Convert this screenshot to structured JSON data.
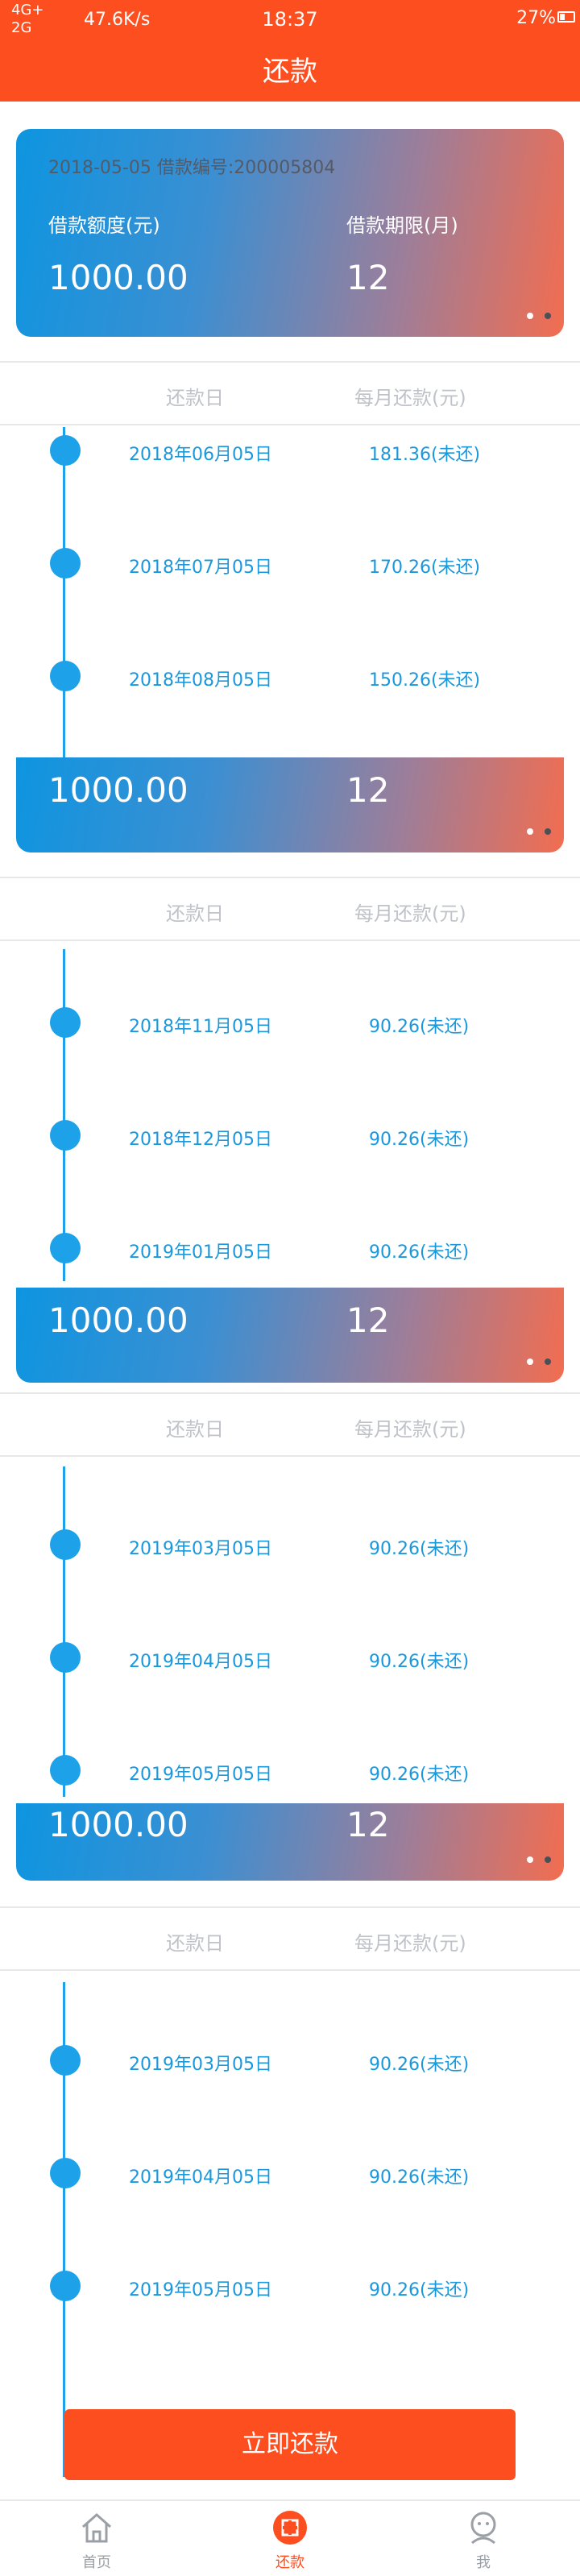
{
  "status_bar": {
    "network_top": "4G+",
    "network_bottom": "2G",
    "speed": "47.6K/s",
    "time": "18:37",
    "battery": "27%"
  },
  "title": "还款",
  "card": {
    "date": "2018-05-05",
    "loan_no_label": "借款编号:200005804",
    "amount_label": "借款额度(元)",
    "term_label": "借款期限(月)",
    "amount": "1000.00",
    "term": "12"
  },
  "table_header": {
    "date_col": "还款日",
    "amount_col": "每月还款(元)"
  },
  "sections": [
    {
      "rows": [
        {
          "date": "2018年06月05日",
          "amount": "181.36(未还)"
        },
        {
          "date": "2018年07月05日",
          "amount": "170.26(未还)"
        },
        {
          "date": "2018年08月05日",
          "amount": "150.26(未还)"
        }
      ]
    },
    {
      "rows": [
        {
          "date": "2018年11月05日",
          "amount": "90.26(未还)"
        },
        {
          "date": "2018年12月05日",
          "amount": "90.26(未还)"
        },
        {
          "date": "2019年01月05日",
          "amount": "90.26(未还)"
        }
      ]
    },
    {
      "rows": [
        {
          "date": "2019年03月05日",
          "amount": "90.26(未还)"
        },
        {
          "date": "2019年04月05日",
          "amount": "90.26(未还)"
        },
        {
          "date": "2019年05月05日",
          "amount": "90.26(未还)"
        }
      ]
    },
    {
      "rows": [
        {
          "date": "2019年03月05日",
          "amount": "90.26(未还)"
        },
        {
          "date": "2019年04月05日",
          "amount": "90.26(未还)"
        },
        {
          "date": "2019年05月05日",
          "amount": "90.26(未还)"
        }
      ]
    }
  ],
  "pay_button": "立即还款",
  "tabs": [
    {
      "label": "首页",
      "icon": "home-icon"
    },
    {
      "label": "还款",
      "icon": "repay-icon"
    },
    {
      "label": "我",
      "icon": "user-icon"
    }
  ],
  "colors": {
    "accent": "#fd4e1f",
    "timeline": "#1da1e8"
  }
}
